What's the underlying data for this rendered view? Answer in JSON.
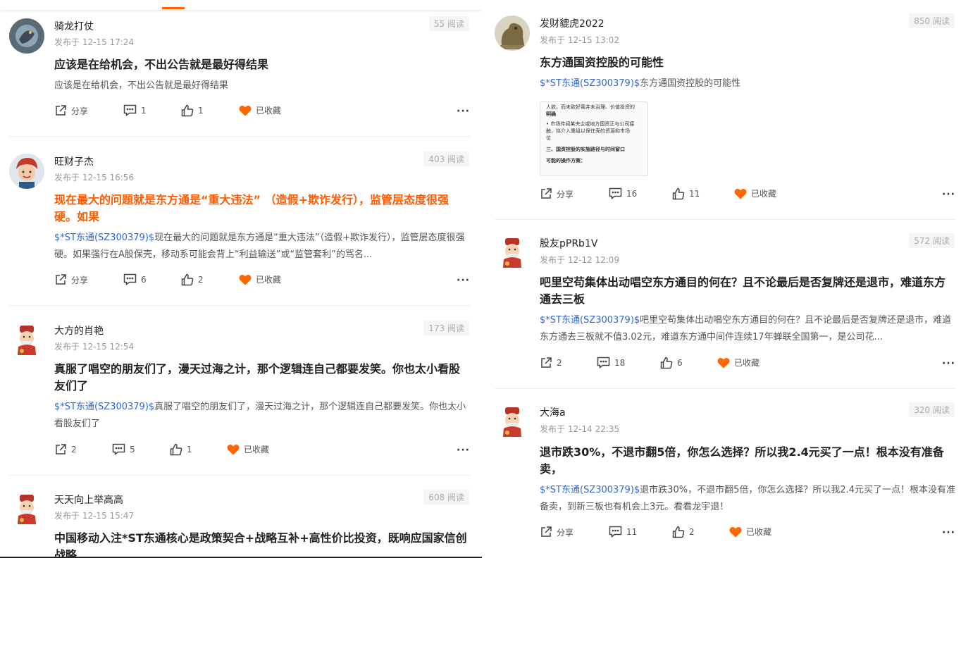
{
  "labels": {
    "share": "分享",
    "collected": "已收藏",
    "more": "···"
  },
  "colors": {
    "accent": "#ff6600",
    "link": "#3066d6",
    "title_hot": "#ff5a00"
  },
  "left_posts": [
    {
      "user": "骑龙打仗",
      "time": "发布于 12-15 17:24",
      "reads": "55 阅读",
      "title": "应该是在给机会，不出公告就是最好得结果",
      "body_tag": "",
      "body": "应该是在给机会，不出公告就是最好得结果",
      "share": "分享",
      "comments": "1",
      "likes": "1",
      "collected": "已收藏",
      "avatar": "dragon-avatar"
    },
    {
      "user": "旺财子杰",
      "time": "发布于 12-15 16:56",
      "reads": "403 阅读",
      "title": "现在最大的问题就是东方通是“重大违法” （造假+欺诈发行），监管层态度很强硬。如果",
      "body_tag": "$*ST东通(SZ300379)$",
      "body": "现在最大的问题就是东方通是“重大违法”（造假+欺诈发行），监管层态度很强硬。如果强行在A股保壳，移动系可能会背上“利益输送”或“监管套利”的骂名...",
      "share": "分享",
      "comments": "6",
      "likes": "2",
      "collected": "已收藏",
      "avatar": "cartoon-boy-avatar"
    },
    {
      "user": "大方的肖艳",
      "time": "发布于 12-15 12:54",
      "reads": "173 阅读",
      "title": "真服了唱空的朋友们了，漫天过海之计，那个逻辑连自己都要发笑。你也太小看股友们了",
      "body_tag": "$*ST东通(SZ300379)$",
      "body": "真服了唱空的朋友们了，漫天过海之计，那个逻辑连自己都要发笑。你也太小看股友们了",
      "share": "2",
      "comments": "5",
      "likes": "1",
      "collected": "已收藏",
      "avatar": "fortune-god-avatar"
    },
    {
      "user": "天天向上举高高",
      "time": "发布于 12-15 15:47",
      "reads": "608 阅读",
      "title": "中国移动入注*ST东通核心是政策契合+战略互补+高性价比投资，既响应国家信创战略",
      "body_tag": "",
      "body": "",
      "share": "",
      "comments": "",
      "likes": "",
      "collected": "",
      "avatar": "fortune-god-avatar"
    }
  ],
  "right_posts": [
    {
      "user": "发财貔虎2022",
      "time": "发布于 12-15 13:02",
      "reads": "850 阅读",
      "title": "东方通国资控股的可能性",
      "body_tag": "$*ST东通(SZ300379)$",
      "body": "东方通国资控股的可能性",
      "share": "分享",
      "comments": "16",
      "likes": "11",
      "collected": "已收藏",
      "avatar": "pixiu-statue-avatar",
      "thumb_lines": [
        "人欲，而未欲好我并未治理、价值投资的",
        "明确",
        "• 市场传闻某央企或地方国资正与公司接",
        "  触，拟介入重组以保住壳的资源和市场",
        "  位",
        "三、国资控股的实施路径与时间窗口",
        "可能的操作方案："
      ]
    },
    {
      "user": "股友pPRb1V",
      "time": "发布于 12-12 12:09",
      "reads": "572 阅读",
      "title": "吧里空苟集体出动唱空东方通目的何在？且不论最后是否复牌还是退市，难道东方通去三板",
      "body_tag": "$*ST东通(SZ300379)$",
      "body": "吧里空苟集体出动唱空东方通目的何在？且不论最后是否复牌还是退市，难道东方通去三板就不值3.02元，难道东方通中间件连续17年蝉联全国第一，是公司花...",
      "share": "2",
      "comments": "18",
      "likes": "6",
      "collected": "已收藏",
      "avatar": "fortune-god-avatar"
    },
    {
      "user": "大海a",
      "time": "发布于 12-14 22:35",
      "reads": "320 阅读",
      "title": "退市跌30%，不退市翻5倍，你怎么选择？所以我2.4元买了一点！根本没有准备卖，",
      "body_tag": "$*ST东通(SZ300379)$",
      "body": "退市跌30%，不退市翻5倍，你怎么选择？所以我2.4元买了一点！根本没有准备卖，到新三板也有机会上3元。看看龙宇退！",
      "share": "分享",
      "comments": "11",
      "likes": "2",
      "collected": "已收藏",
      "avatar": "fortune-god-avatar"
    }
  ]
}
